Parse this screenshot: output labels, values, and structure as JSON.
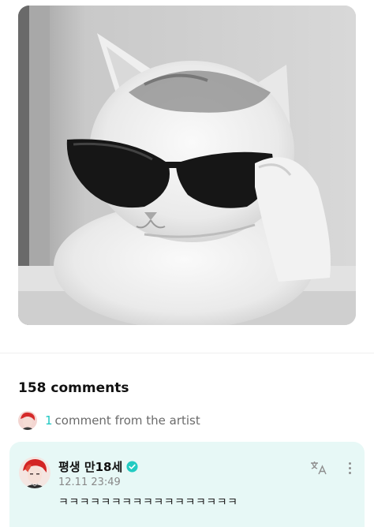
{
  "post": {
    "image_description_icon": "cat-sunglasses-photo"
  },
  "comments": {
    "count_label": "158 comments",
    "artist_count": "1",
    "artist_label": "comment from the artist"
  },
  "comment": {
    "author": "평생 만18세",
    "time": "12.11 23:49",
    "text": "ㅋㅋㅋㅋㅋㅋㅋㅋㅋㅋㅋㅋㅋㅋㅋㅋㅋ",
    "translate_icon": "translate-icon",
    "more_icon": "more-vertical-icon"
  },
  "colors": {
    "accent": "#1ec8c2",
    "card_bg": "#e7f8f6",
    "verified": "#22cbc2"
  }
}
